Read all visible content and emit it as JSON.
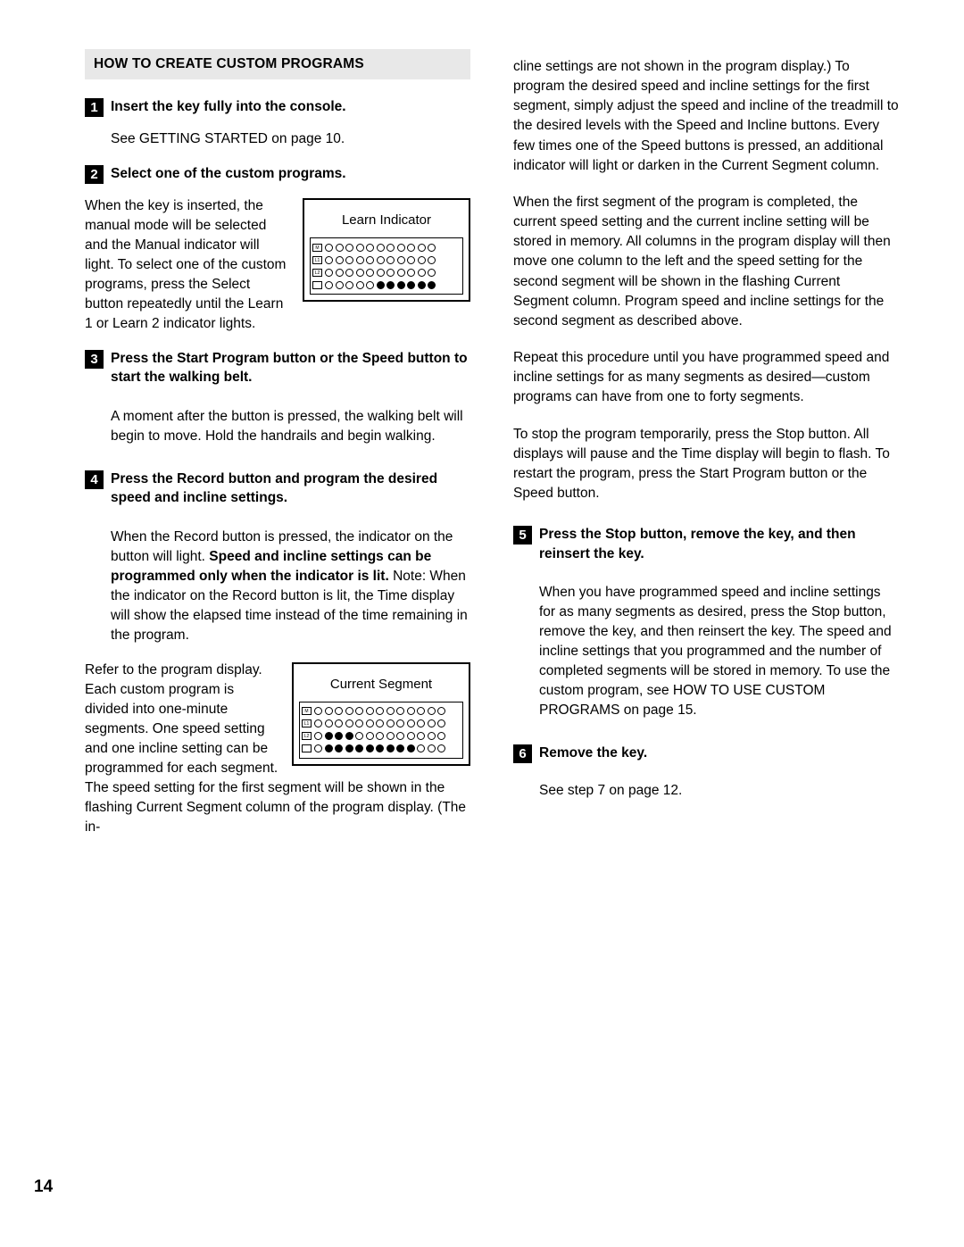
{
  "page": {
    "number": "14",
    "section_title": "HOW TO CREATE CUSTOM PROGRAMS"
  },
  "left_column": {
    "steps": [
      {
        "num": "1",
        "heading": "Insert the key fully into the console.",
        "body": "See GETTING STARTED on page 10."
      },
      {
        "num": "2",
        "heading": "Select one of the custom programs."
      },
      {
        "num": "3",
        "heading": "Press the Start Program button or the Speed button to start the walking belt.",
        "body": "A moment after the button is pressed, the walking belt will begin to move. Hold the handrails and begin walking."
      },
      {
        "num": "4",
        "heading": "Press the Record button and program the desired speed and incline settings."
      }
    ],
    "para_step2": "When the key is inserted, the manual mode will be selected and the Manual indicator will light. To select one of the custom programs, press the Select button repeatedly until the Learn 1 or Learn 2 indicator lights.",
    "para_step4_a": "When the Record button is pressed, the indicator on the button will light. ",
    "para_step4_bold": "Speed and incline settings can be programmed only when the indicator is lit.",
    "para_step4_b": " Note: When the indicator on the Record button is lit, the Time display will show the elapsed time instead of the time remaining in the program.",
    "para_step4_c": "Refer to the program display. Each custom program is divided into one-minute segments. One speed setting and one incline setting can be programmed for each segment. The speed setting for the first segment will be shown in the flashing Current Segment column of the program display. (The in-"
  },
  "figures": {
    "learn_indicator": {
      "caption": "Learn Indicator",
      "row_tags": [
        "M",
        "L1",
        "L2",
        ""
      ],
      "rows": [
        {
          "dots": 11,
          "filled": 0
        },
        {
          "dots": 11,
          "filled": 0
        },
        {
          "dots": 11,
          "filled": 0
        },
        {
          "dots": 11,
          "filled": 6
        }
      ]
    },
    "current_segment": {
      "caption": "Current Segment",
      "row_tags": [
        "M",
        "L1",
        "L2",
        ""
      ],
      "rows": [
        {
          "dots": 13,
          "filled": 0
        },
        {
          "dots": 13,
          "filled": 0
        },
        {
          "dots": 13,
          "filled": 3
        },
        {
          "dots": 13,
          "filled": 9
        }
      ]
    }
  },
  "right_column": {
    "paragraphs": [
      "cline settings are not shown in the program display.) To program the desired speed and incline settings for the first segment, simply adjust the speed and incline of the treadmill to the desired levels with the Speed and Incline buttons. Every few times one of the Speed buttons is pressed, an additional indicator will light or darken in the Current Segment column.",
      "When the first segment of the program is completed, the current speed setting and the current incline setting will be stored in memory. All columns in the program display will then move one column to the left and the speed setting for the second segment will be shown in the flashing Current Segment column. Program speed and incline settings for the second segment as described above.",
      "Repeat this procedure until you have programmed speed and incline settings for as many segments as desired—custom programs can have from one to forty segments.",
      "To stop the program temporarily, press the Stop button. All displays will pause and the Time display will begin to flash. To restart the program, press the Start Program button or the Speed button."
    ],
    "steps": [
      {
        "num": "5",
        "heading": "Press the Stop button, remove the key, and then reinsert the key.",
        "body": "When you have programmed speed and incline settings for as many segments as desired, press the Stop button, remove the key, and then reinsert the key. The speed and incline settings that you programmed and the number of completed segments will be stored in memory. To use the custom program, see HOW TO USE CUSTOM PROGRAMS on page 15."
      },
      {
        "num": "6",
        "heading": "Remove the key.",
        "body": "See step 7 on page 12."
      }
    ]
  }
}
